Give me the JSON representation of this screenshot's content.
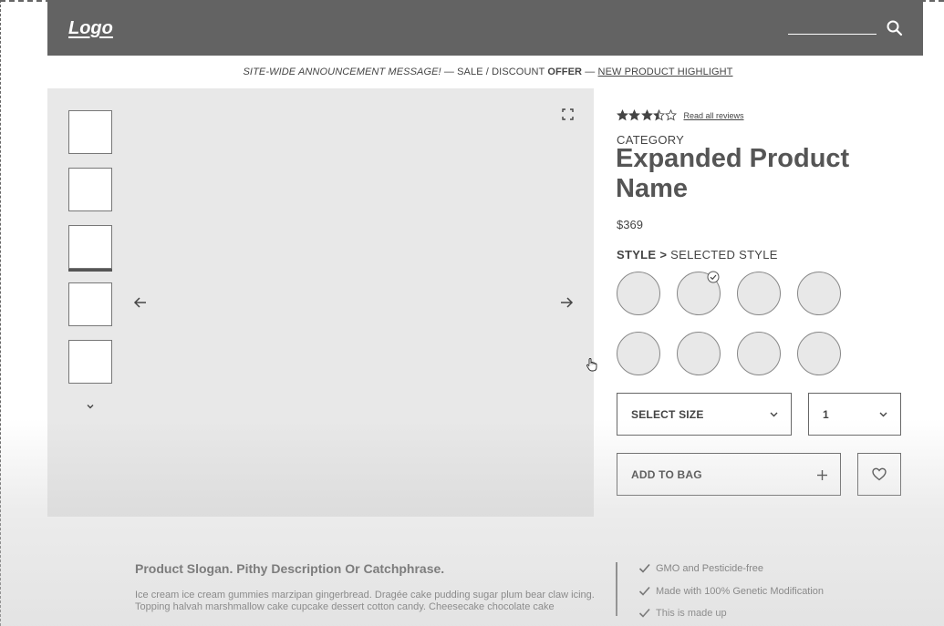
{
  "header": {
    "logo": "Logo",
    "search_icon": "search-icon"
  },
  "announcement": {
    "part1": "SITE-WIDE ANNOUNCEMENT MESSAGE!",
    "sep1": " — ",
    "part2": "SALE / DISCOUNT ",
    "part2_bold": "OFFER",
    "sep2": " — ",
    "part3": "NEW PRODUCT HIGHLIGHT"
  },
  "gallery": {
    "thumbnails": 5,
    "selected_thumbnail": 3,
    "icons": [
      "expand-icon",
      "arrow-left-icon",
      "arrow-right-icon",
      "chevron-down-icon"
    ]
  },
  "product": {
    "rating": 3.5,
    "rating_max": 5,
    "reviews_link": "Read all reviews",
    "category": "CATEGORY",
    "name": "Expanded Product Name",
    "price": "$369",
    "style_label": "STYLE",
    "style_sep": ">",
    "style_value": "SELECTED STYLE",
    "selected_swatch": 2
  },
  "purchase": {
    "size_label": "SELECT SIZE",
    "quantity": "1",
    "add_to_bag": "ADD TO BAG",
    "plus_icon": "plus-icon",
    "heart_icon": "heart-icon"
  },
  "details": {
    "slogan": "Product Slogan. Pithy Description Or Catchphrase.",
    "description": "Ice cream ice cream gummies marzipan gingerbread. Dragée cake pudding sugar plum bear claw icing. Topping halvah marshmallow cake cupcake dessert cotton candy. Cheesecake chocolate cake",
    "features": [
      "GMO and Pesticide-free",
      "Made with 100% Genetic Modification",
      "This is made up"
    ]
  },
  "colors": {
    "header_bg": "#636363",
    "gallery_bg": "#e8e8e8",
    "border": "#666666"
  }
}
